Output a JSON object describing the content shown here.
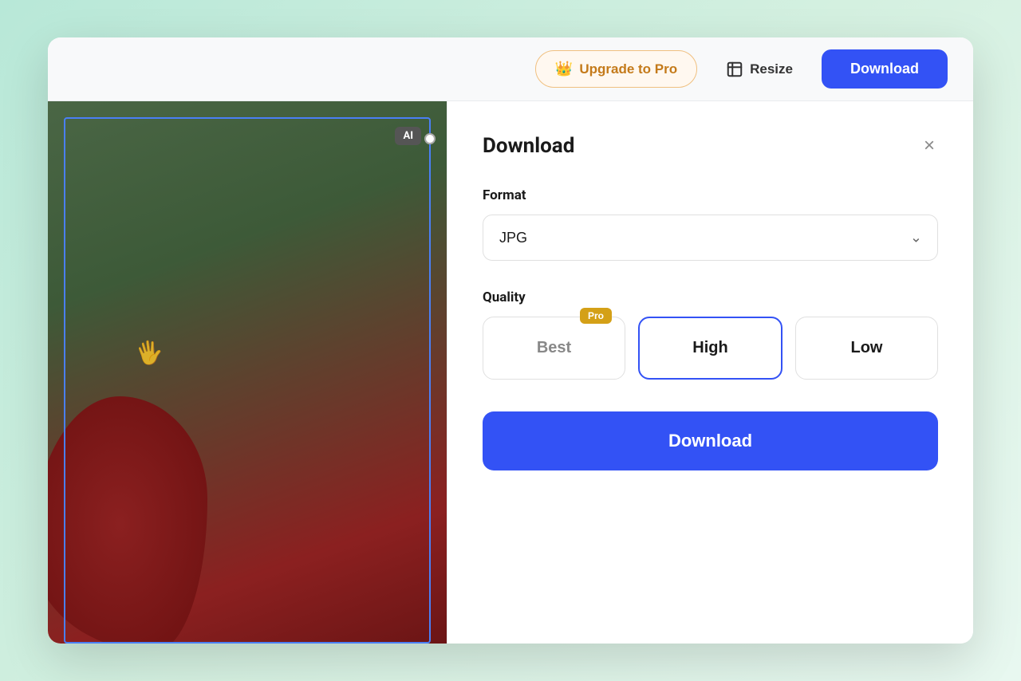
{
  "topbar": {
    "upgrade_label": "Upgrade to Pro",
    "resize_label": "Resize",
    "download_header_label": "Download"
  },
  "canvas": {
    "ai_badge": "AI"
  },
  "panel": {
    "title": "Download",
    "format_section": "Format",
    "format_value": "JPG",
    "quality_section": "Quality",
    "quality_options": [
      {
        "id": "best",
        "label": "Best",
        "pro": true,
        "selected": false
      },
      {
        "id": "high",
        "label": "High",
        "pro": false,
        "selected": true
      },
      {
        "id": "low",
        "label": "Low",
        "pro": false,
        "selected": false
      }
    ],
    "download_btn_label": "Download",
    "close_label": "×"
  },
  "colors": {
    "primary_blue": "#3352f5",
    "pro_gold": "#d4a017",
    "upgrade_text": "#c47a1a",
    "upgrade_bg": "#fff8f0"
  }
}
